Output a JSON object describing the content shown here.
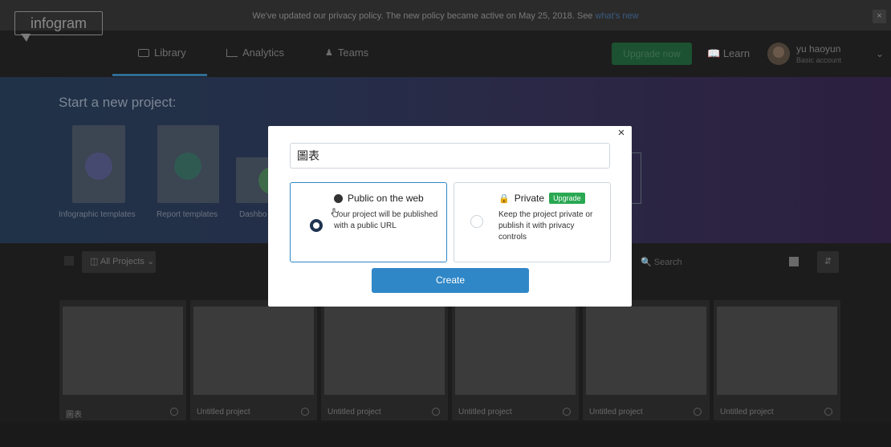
{
  "banner": {
    "text": "We've updated our privacy policy. The new policy became active on May 25, 2018. See",
    "link": "what's new",
    "close": "×"
  },
  "nav": {
    "logo": "infogram",
    "tabs": [
      "Library",
      "Analytics",
      "Teams"
    ],
    "upgrade": "Upgrade now",
    "learn": "Learn",
    "user_name": "yu haoyun",
    "user_type": "Basic account"
  },
  "hero": {
    "title": "Start a new project:",
    "templates": [
      "Infographic templates",
      "Report templates",
      "Dashbo"
    ]
  },
  "toolbar": {
    "filter": "All Projects",
    "search_placeholder": "Search"
  },
  "projects": [
    "圖表",
    "Untitled project",
    "Untitled project",
    "Untitled project",
    "Untitled project",
    "Untitled project"
  ],
  "modal": {
    "input_value": "圖表",
    "public_title": "Public on the web",
    "public_desc": "Your project will be published with a public URL",
    "private_title": "Private",
    "private_badge": "Upgrade",
    "private_desc": "Keep the project private or publish it with privacy controls",
    "create": "Create",
    "close": "×"
  },
  "colors": {
    "accent": "#2f87c7",
    "upgrade_green": "#2aa852"
  }
}
